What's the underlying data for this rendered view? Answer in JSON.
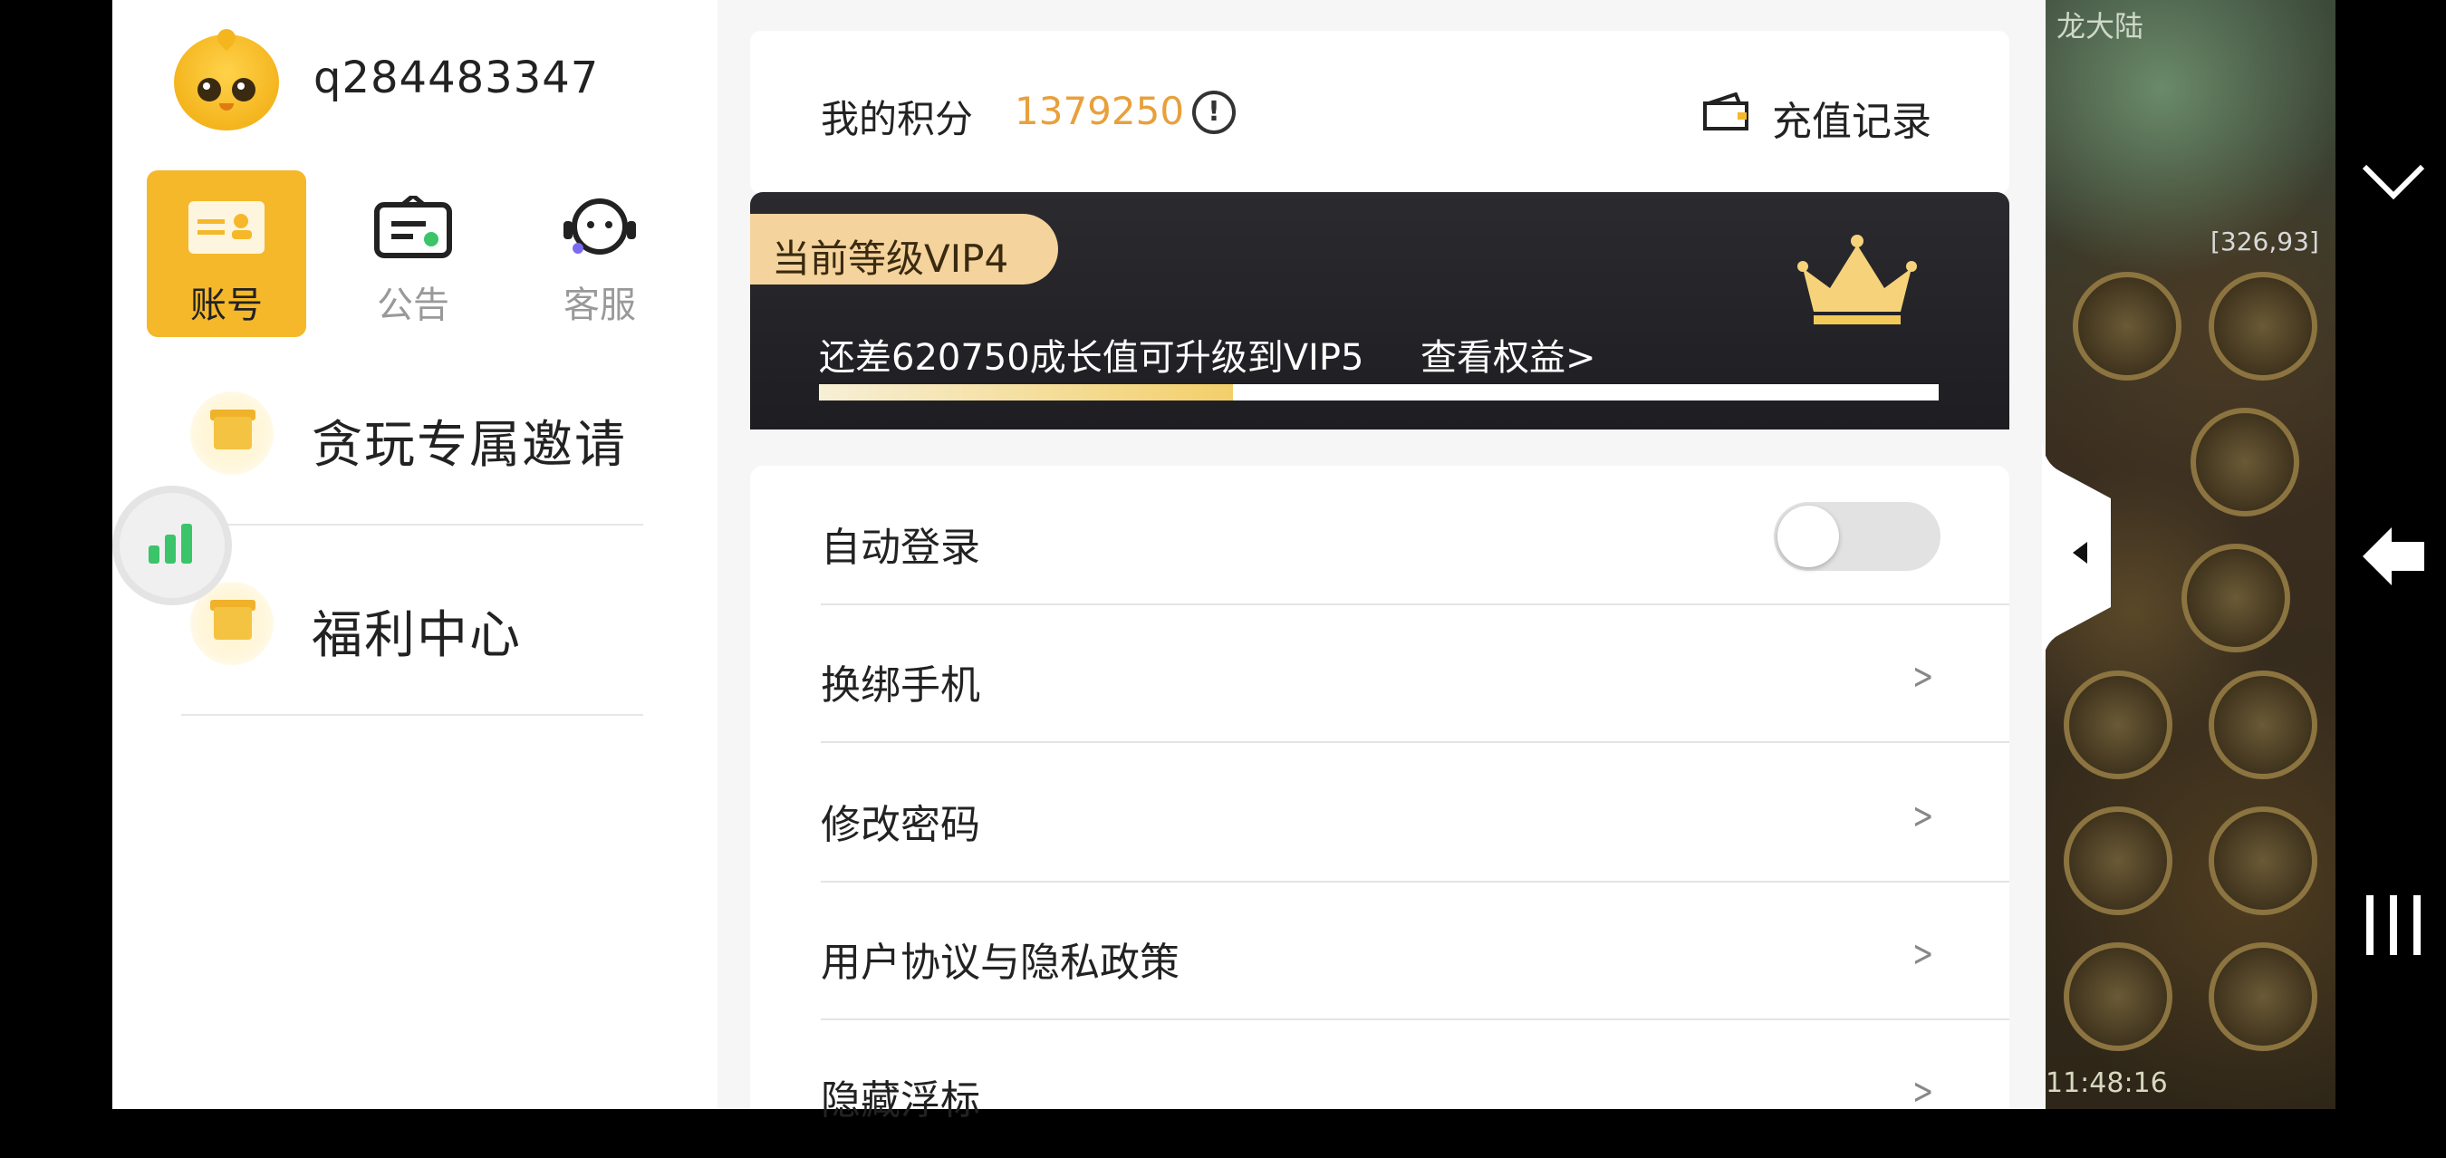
{
  "user": {
    "username": "q284483347"
  },
  "nav_tabs": [
    {
      "label": "账号",
      "icon": "account-card-icon",
      "active": true
    },
    {
      "label": "公告",
      "icon": "notice-board-icon",
      "active": false
    },
    {
      "label": "客服",
      "icon": "headset-icon",
      "active": false
    }
  ],
  "sidebar_menu": [
    {
      "label": "贪玩专属邀请",
      "icon": "gift-box-icon"
    },
    {
      "label": "福利中心",
      "icon": "gift-icon"
    }
  ],
  "points": {
    "label": "我的积分",
    "value": "1379250"
  },
  "recharge": {
    "label": "充值记录"
  },
  "vip": {
    "level_label": "当前等级VIP4",
    "progress_text": "还差620750成长值可升级到VIP5",
    "benefits_link": "查看权益>",
    "progress_fraction": 0.37,
    "accent": "#f4d39c"
  },
  "settings": [
    {
      "label": "自动登录",
      "type": "toggle",
      "value": false
    },
    {
      "label": "换绑手机",
      "type": "link"
    },
    {
      "label": "修改密码",
      "type": "link"
    },
    {
      "label": "用户协议与隐私政策",
      "type": "link"
    },
    {
      "label": "隐藏浮标",
      "type": "link"
    }
  ],
  "game": {
    "map_title": "龙大陆",
    "coords": "[326,93]",
    "time": "11:48:16"
  },
  "colors": {
    "active_tab": "#f5b82a",
    "points_value": "#e8a03c",
    "vip_card": "#1e1e22"
  }
}
